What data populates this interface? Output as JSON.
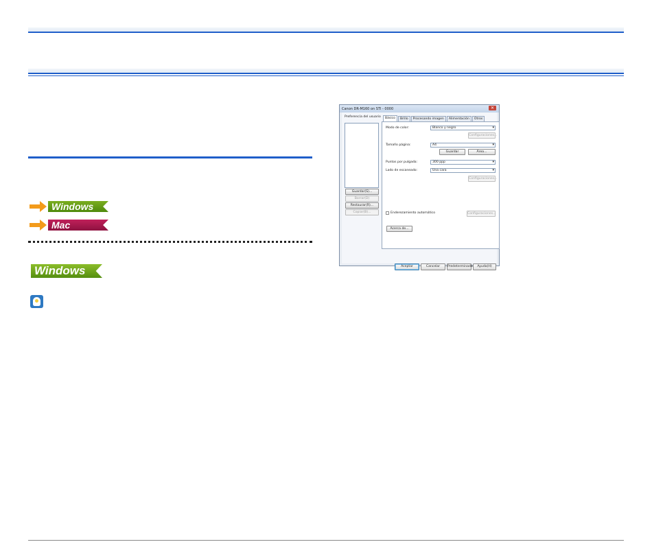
{
  "os_links": [
    {
      "label": "Windows",
      "color": "#5f9a14"
    },
    {
      "label": "Mac",
      "color": "#a8184d"
    }
  ],
  "section_badge": "Windows",
  "colors": {
    "rule": "#1f5ec9",
    "arrow": "#f39b1b"
  },
  "dialog": {
    "title": "Canon DR-M160 on STI - 0000",
    "close_glyph": "✕",
    "preferences_label": "Preferencia del usuario",
    "side_buttons": [
      {
        "label": "Guardar(S)...",
        "enabled": true
      },
      {
        "label": "Borrar(D)",
        "enabled": false
      },
      {
        "label": "Restaurar(R)...",
        "enabled": true
      },
      {
        "label": "Copiar(B)...",
        "enabled": false
      }
    ],
    "tabs": [
      "Básico",
      "Brillo",
      "Procesando imagen",
      "Alimentación",
      "Otros"
    ],
    "active_tab": "Básico",
    "fields": {
      "color_mode_label": "Modo de color:",
      "color_mode_value": "Blanco y negro",
      "color_settings": "Configuraciones...",
      "page_size_label": "Tamaño página:",
      "page_size_value": "A4",
      "save_size": "Guardar",
      "add_size": "Área...",
      "dpi_label": "Puntos por pulgada:",
      "dpi_value": "300 ppp",
      "side_label": "Lado de escaneado:",
      "side_value": "Una cara",
      "side_settings": "Configuraciones...",
      "deskew_label": "Enderezamiento automático",
      "deskew_settings": "Configuraciones...",
      "about": "Acerca de..."
    },
    "footer_buttons": [
      "Aceptar",
      "Cancelar",
      "Predeterminado",
      "Ayuda(H)"
    ]
  }
}
